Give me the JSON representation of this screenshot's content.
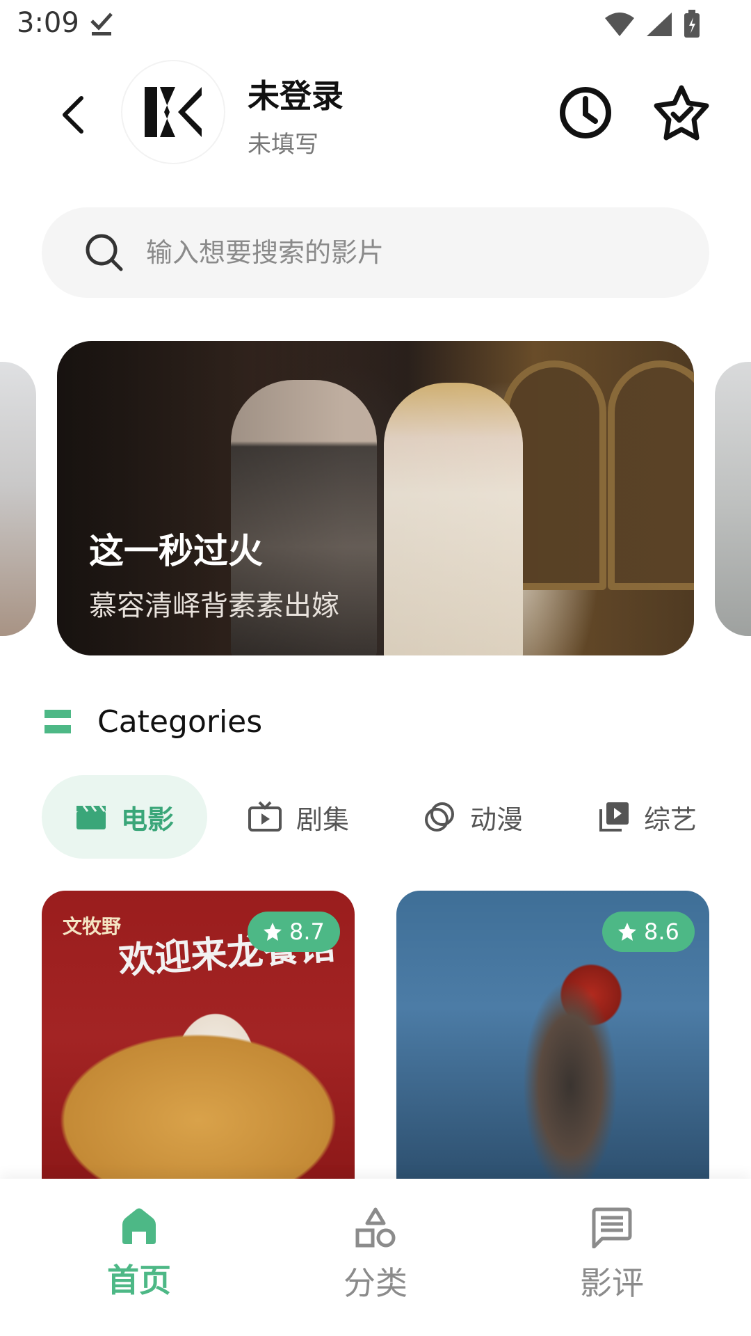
{
  "status_bar": {
    "time": "3:09"
  },
  "header": {
    "user_name": "未登录",
    "user_sub": "未填写"
  },
  "search": {
    "placeholder": "输入想要搜索的影片"
  },
  "banner": {
    "title": "这一秒过火",
    "subtitle": "慕容清峄背素素出嫁"
  },
  "categories": {
    "title": "Categories",
    "tabs": [
      {
        "label": "电影",
        "icon": "clapperboard-icon",
        "active": true
      },
      {
        "label": "剧集",
        "icon": "tv-icon",
        "active": false
      },
      {
        "label": "动漫",
        "icon": "anime-icon",
        "active": false
      },
      {
        "label": "综艺",
        "icon": "video-library-icon",
        "active": false
      }
    ]
  },
  "posters": [
    {
      "rating": "8.7",
      "top_text": "文牧野",
      "title_text": "欢迎来龙餐馆"
    },
    {
      "rating": "8.6"
    }
  ],
  "bottom_nav": [
    {
      "label": "首页",
      "icon": "home-icon",
      "active": true
    },
    {
      "label": "分类",
      "icon": "shapes-icon",
      "active": false
    },
    {
      "label": "影评",
      "icon": "comment-icon",
      "active": false
    }
  ],
  "colors": {
    "accent": "#4db886",
    "accent_light": "#eaf6f0",
    "text_muted": "#8b8b8b"
  }
}
